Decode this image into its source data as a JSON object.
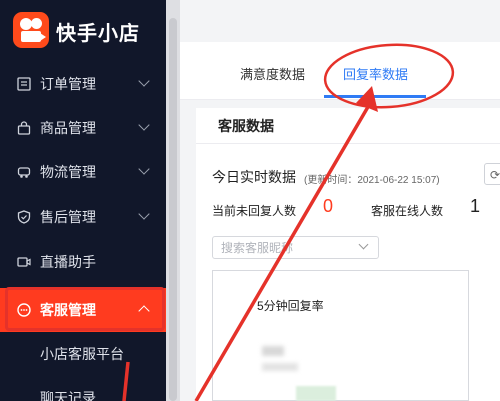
{
  "app": {
    "brand": "快手小店"
  },
  "sidebar": {
    "items": [
      {
        "label": "订单管理",
        "icon": "list-icon"
      },
      {
        "label": "商品管理",
        "icon": "bag-icon"
      },
      {
        "label": "物流管理",
        "icon": "truck-icon"
      },
      {
        "label": "售后管理",
        "icon": "shield-icon"
      },
      {
        "label": "直播助手",
        "icon": "live-icon"
      },
      {
        "label": "客服管理",
        "icon": "chat-icon",
        "active": true
      }
    ],
    "sub_items": [
      {
        "label": "小店客服平台"
      },
      {
        "label": "聊天记录"
      }
    ]
  },
  "tabs": [
    {
      "label": "满意度数据"
    },
    {
      "label": "回复率数据",
      "active": true
    }
  ],
  "section": {
    "title": "客服数据"
  },
  "realtime": {
    "title": "今日实时数据",
    "update_time": "(更新时间：2021-06-22 15:07)",
    "refresh_icon": "refresh-icon"
  },
  "stats": [
    {
      "label": "当前未回复人数",
      "value": "0"
    },
    {
      "label": "客服在线人数",
      "value": "1"
    }
  ],
  "search": {
    "placeholder": "搜索客服昵称"
  },
  "metric": {
    "title": "5分钟回复率"
  },
  "colors": {
    "accent": "#ff3b1f",
    "sidebar": "#11172a",
    "link": "#2f7bf5",
    "annotation": "#e5322a"
  }
}
